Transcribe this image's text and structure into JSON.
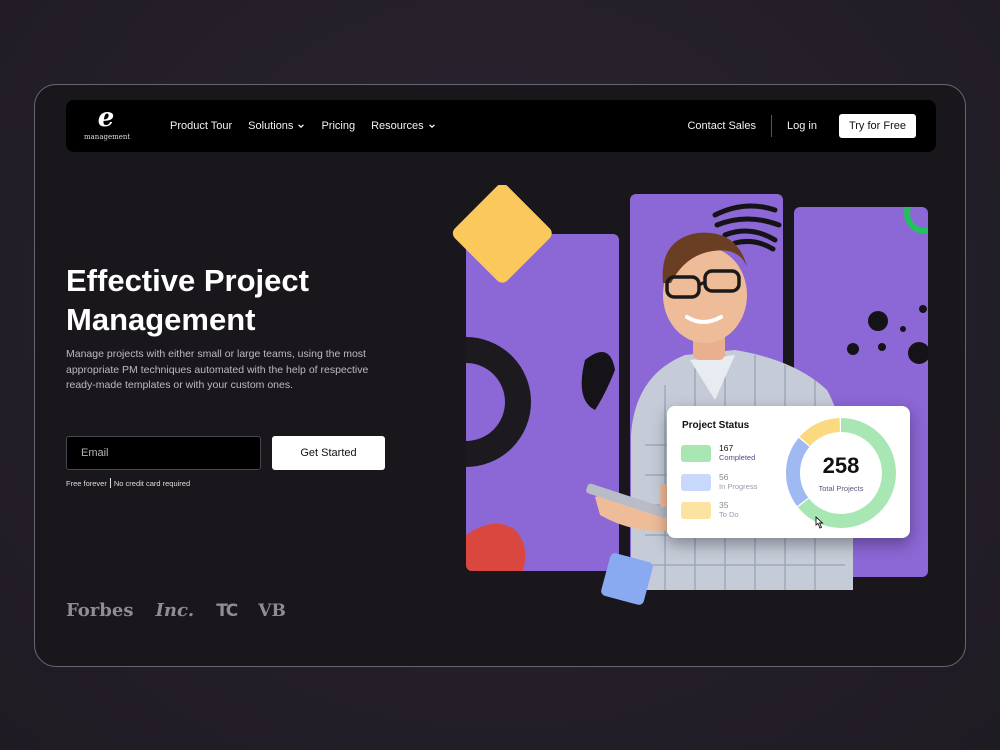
{
  "brand": {
    "mark": "e",
    "name": "management"
  },
  "nav": {
    "links": [
      {
        "label": "Product Tour",
        "dropdown": false
      },
      {
        "label": "Solutions",
        "dropdown": true
      },
      {
        "label": "Pricing",
        "dropdown": false
      },
      {
        "label": "Resources",
        "dropdown": true
      }
    ],
    "contact_label": "Contact Sales",
    "login_label": "Log in",
    "cta_label": "Try for Free"
  },
  "hero": {
    "title_line1": "Effective Project",
    "title_line2": "Management",
    "description": "Manage projects with either small or large teams, using the most appropriate PM techniques automated with the help of respective ready-made templates or with your custom ones.",
    "email_placeholder": "Email",
    "email_value": "",
    "cta_label": "Get Started",
    "fine_print_1": "Free forever",
    "fine_print_2": "No credit card required"
  },
  "press_logos": [
    "Forbes",
    "Inc.",
    "TC",
    "VB"
  ],
  "project_status": {
    "title": "Project Status",
    "items": [
      {
        "count": "167",
        "label": "Completed",
        "color": "#a8e6b4"
      },
      {
        "count": "56",
        "label": "In Progress",
        "color": "#a9c4f5"
      },
      {
        "count": "35",
        "label": "To Do",
        "color": "#fbd97e"
      }
    ],
    "total": "258",
    "total_label": "Total Projects"
  },
  "colors": {
    "accent_purple": "#8c67d6",
    "yellow": "#fbc95b",
    "blue": "#89a9f0",
    "red": "#d9473f",
    "green": "#21c25e"
  },
  "icons": [
    "chevron-down-icon",
    "cursor-icon"
  ]
}
